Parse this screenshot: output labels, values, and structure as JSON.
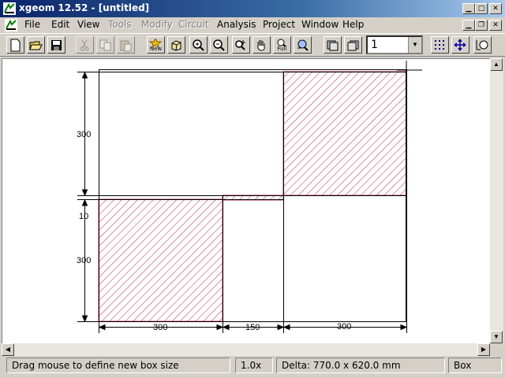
{
  "window": {
    "title": "xgeom 12.52 - [untitled]",
    "controls": [
      "minimize",
      "maximize",
      "close"
    ]
  },
  "menu": {
    "items": [
      {
        "label": "File",
        "enabled": true
      },
      {
        "label": "Edit",
        "enabled": true
      },
      {
        "label": "View",
        "enabled": true
      },
      {
        "label": "Tools",
        "enabled": false
      },
      {
        "label": "Modify",
        "enabled": false
      },
      {
        "label": "Circuit",
        "enabled": false
      },
      {
        "label": "Analysis",
        "enabled": true
      },
      {
        "label": "Project",
        "enabled": true
      },
      {
        "label": "Window",
        "enabled": true
      },
      {
        "label": "Help",
        "enabled": true
      }
    ]
  },
  "toolbar": {
    "new_label": "New",
    "full_label": "Full",
    "layer_value": "1"
  },
  "drawing": {
    "dimensions": {
      "left_top": "300",
      "left_gap": "10",
      "left_bottom": "300",
      "bottom_1": "300",
      "bottom_2": "150",
      "bottom_3": "300"
    },
    "hatch_color": "#b03050"
  },
  "status": {
    "message": "Drag mouse to define new box size",
    "zoom": "1.0x",
    "delta": "Delta: 770.0 x 620.0 mm",
    "mode": "Box"
  }
}
